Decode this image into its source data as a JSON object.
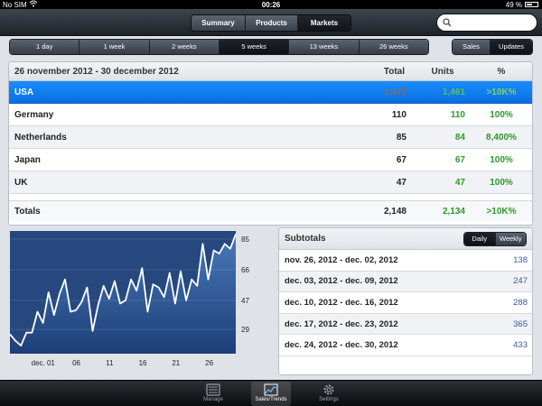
{
  "status": {
    "carrier": "No SIM",
    "time": "00:26",
    "battery": "49 %"
  },
  "nav": {
    "segments": [
      {
        "label": "Summary",
        "active": false
      },
      {
        "label": "Products",
        "active": false
      },
      {
        "label": "Markets",
        "active": true
      }
    ]
  },
  "ranges": [
    "1 day",
    "1 week",
    "2 weeks",
    "5 weeks",
    "13 weeks",
    "26 weeks"
  ],
  "active_range": "5 weeks",
  "type_toggle": [
    "Sales",
    "Updates"
  ],
  "table": {
    "period": "26 november 2012 - 30 december 2012",
    "headers": {
      "total": "Total",
      "units": "Units",
      "pct": "%"
    },
    "rows": [
      {
        "name": "USA",
        "total": "1,471",
        "units": "1,461",
        "pct": ">10K%",
        "selected": true
      },
      {
        "name": "Germany",
        "total": "110",
        "units": "110",
        "pct": "100%"
      },
      {
        "name": "Netherlands",
        "total": "85",
        "units": "84",
        "pct": "8,400%"
      },
      {
        "name": "Japan",
        "total": "67",
        "units": "67",
        "pct": "100%"
      },
      {
        "name": "UK",
        "total": "47",
        "units": "47",
        "pct": "100%"
      }
    ],
    "totals": {
      "label": "Totals",
      "total": "2,148",
      "units": "2,134",
      "pct": ">10K%"
    }
  },
  "chart_data": {
    "type": "area",
    "x_ticks": [
      "dec. 01",
      "06",
      "11",
      "16",
      "21",
      "26"
    ],
    "y_ticks": [
      85,
      66,
      47,
      29
    ],
    "ylim": [
      14,
      90
    ],
    "values": [
      26,
      22,
      19,
      27,
      27,
      40,
      33,
      52,
      38,
      51,
      60,
      40,
      41,
      46,
      55,
      28,
      44,
      56,
      48,
      59,
      45,
      47,
      60,
      53,
      67,
      40,
      57,
      55,
      49,
      64,
      45,
      65,
      47,
      60,
      56,
      82,
      60,
      78,
      76,
      82,
      79,
      88
    ],
    "colors": {
      "fill_top": "#4a78b8",
      "fill_bottom": "#1c3f78",
      "line": "#ffffff"
    }
  },
  "subtotals": {
    "title": "Subtotals",
    "toggle": [
      "Daily",
      "Weekly"
    ],
    "rows": [
      {
        "label": "nov. 26, 2012 - dec. 02, 2012",
        "value": "138"
      },
      {
        "label": "dec. 03, 2012 - dec. 09, 2012",
        "value": "247"
      },
      {
        "label": "dec. 10, 2012 - dec. 16, 2012",
        "value": "288"
      },
      {
        "label": "dec. 17, 2012 - dec. 23, 2012",
        "value": "365"
      },
      {
        "label": "dec. 24, 2012 - dec. 30, 2012",
        "value": "433"
      }
    ]
  },
  "tabs": [
    {
      "label": "Manage",
      "icon": "manage-icon",
      "active": false
    },
    {
      "label": "Sales/Trends",
      "icon": "trends-icon",
      "active": true
    },
    {
      "label": "Settings",
      "icon": "gear-icon",
      "active": false
    }
  ]
}
